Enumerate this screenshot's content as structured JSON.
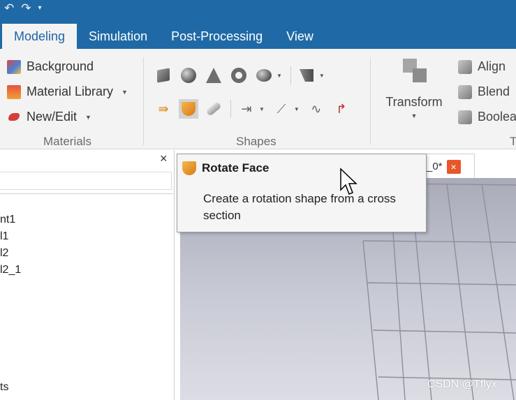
{
  "quick_access": {
    "undo_icon": "undo-icon",
    "redo_icon": "redo-icon",
    "customize_icon": "customize-qat-icon"
  },
  "tabs": [
    {
      "label": "Modeling",
      "active": true
    },
    {
      "label": "Simulation",
      "active": false
    },
    {
      "label": "Post-Processing",
      "active": false
    },
    {
      "label": "View",
      "active": false
    }
  ],
  "ribbon": {
    "materials": {
      "label": "Materials",
      "background": "Background",
      "material_library": "Material Library",
      "new_edit": "New/Edit"
    },
    "shapes": {
      "label": "Shapes"
    },
    "transform": {
      "transform": "Transform",
      "align": "Align",
      "blend": "Blend",
      "boolean": "Boolea",
      "group_label_partial": "T"
    }
  },
  "left_panel": {
    "close": "×",
    "search_value": "",
    "tree": [
      "nt1",
      "l1",
      "l2",
      "l2_1",
      "ts"
    ]
  },
  "document_tab": {
    "label": "_0*",
    "close": "×"
  },
  "tooltip": {
    "title": "Rotate Face",
    "description": "Create a rotation shape from a cross section"
  },
  "watermark": "CSDN @Tflyx",
  "colors": {
    "titlebar": "#1f6aa6",
    "active_tab_text": "#1d64a8",
    "ribbon_bg": "#f3f3f3",
    "doc_tab_close": "#e8572a"
  }
}
